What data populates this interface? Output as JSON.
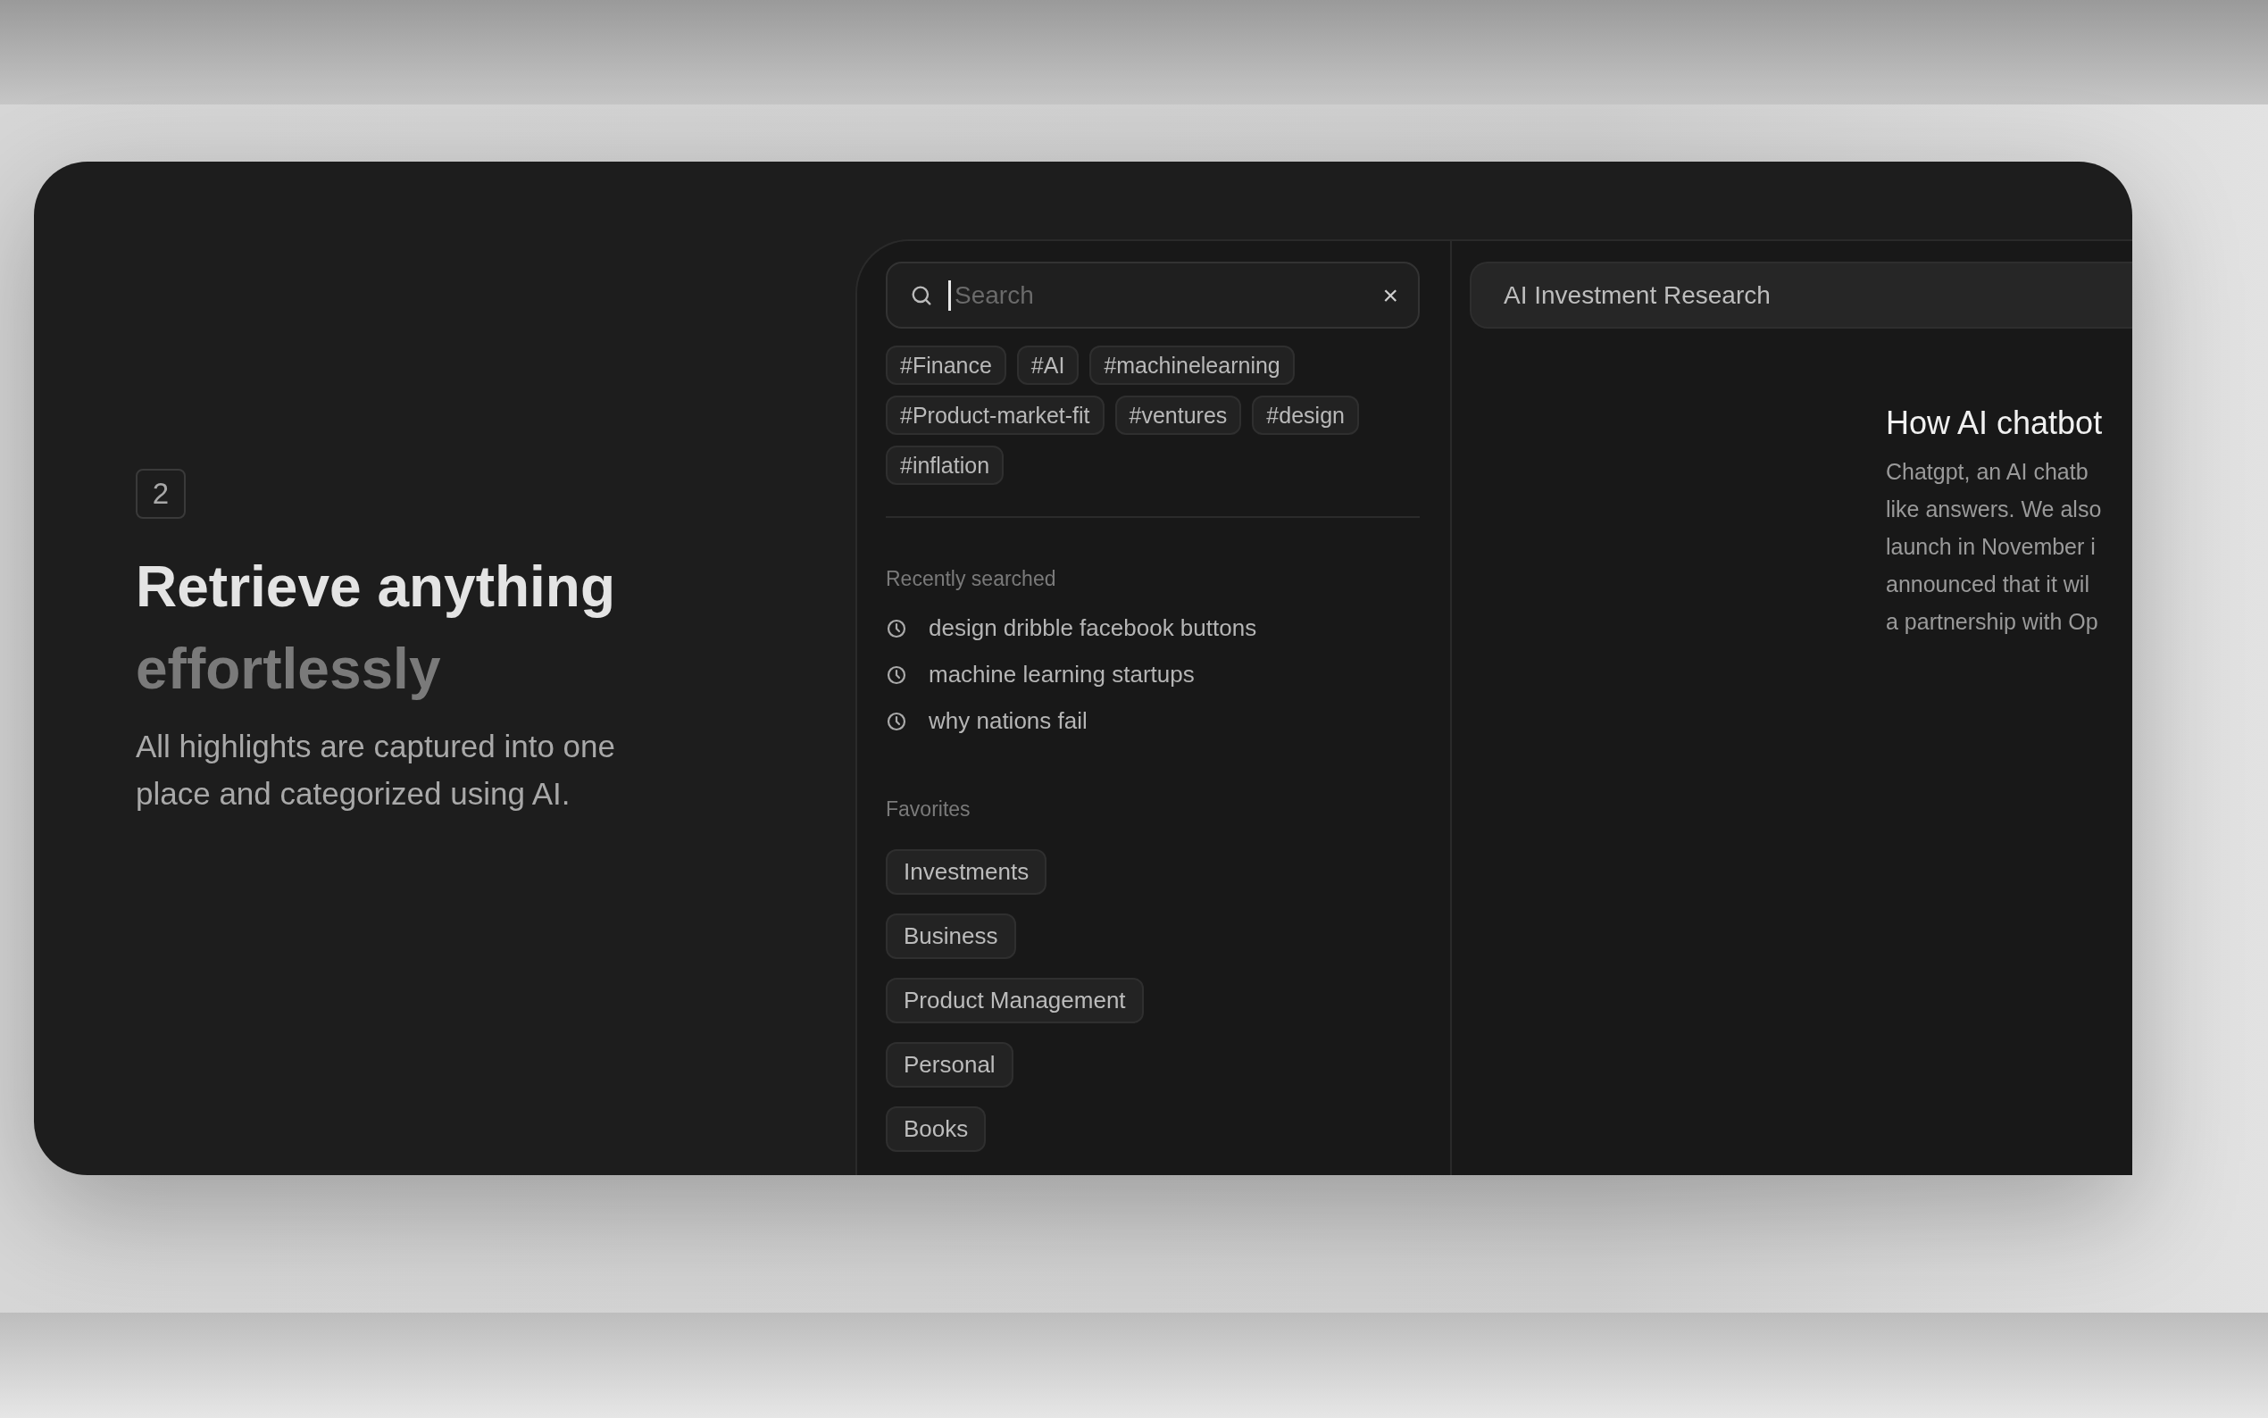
{
  "step": {
    "number": "2"
  },
  "headline": {
    "primary": "Retrieve anything",
    "secondary": "effortlessly"
  },
  "description": "All highlights are captured into one place and categorized using AI.",
  "search": {
    "placeholder": "Search",
    "focused": true,
    "clear_label": "×"
  },
  "tags": [
    "#Finance",
    "#AI",
    "#machinelearning",
    "#Product-market-fit",
    "#ventures",
    "#design",
    "#inflation"
  ],
  "recent": {
    "title": "Recently searched",
    "items": [
      "design dribble facebook buttons",
      "machine learning startups",
      "why nations fail"
    ]
  },
  "favorites": {
    "title": "Favorites",
    "items": [
      "Investments",
      "Business",
      "Product Management",
      "Personal",
      "Books"
    ]
  },
  "document": {
    "title": "AI Investment Research",
    "heading": "How AI chatbot",
    "lines": [
      "Chatgpt, an AI chatb",
      "like answers. We also",
      "launch in November i",
      "announced that it wil",
      "a partnership with Op"
    ]
  }
}
